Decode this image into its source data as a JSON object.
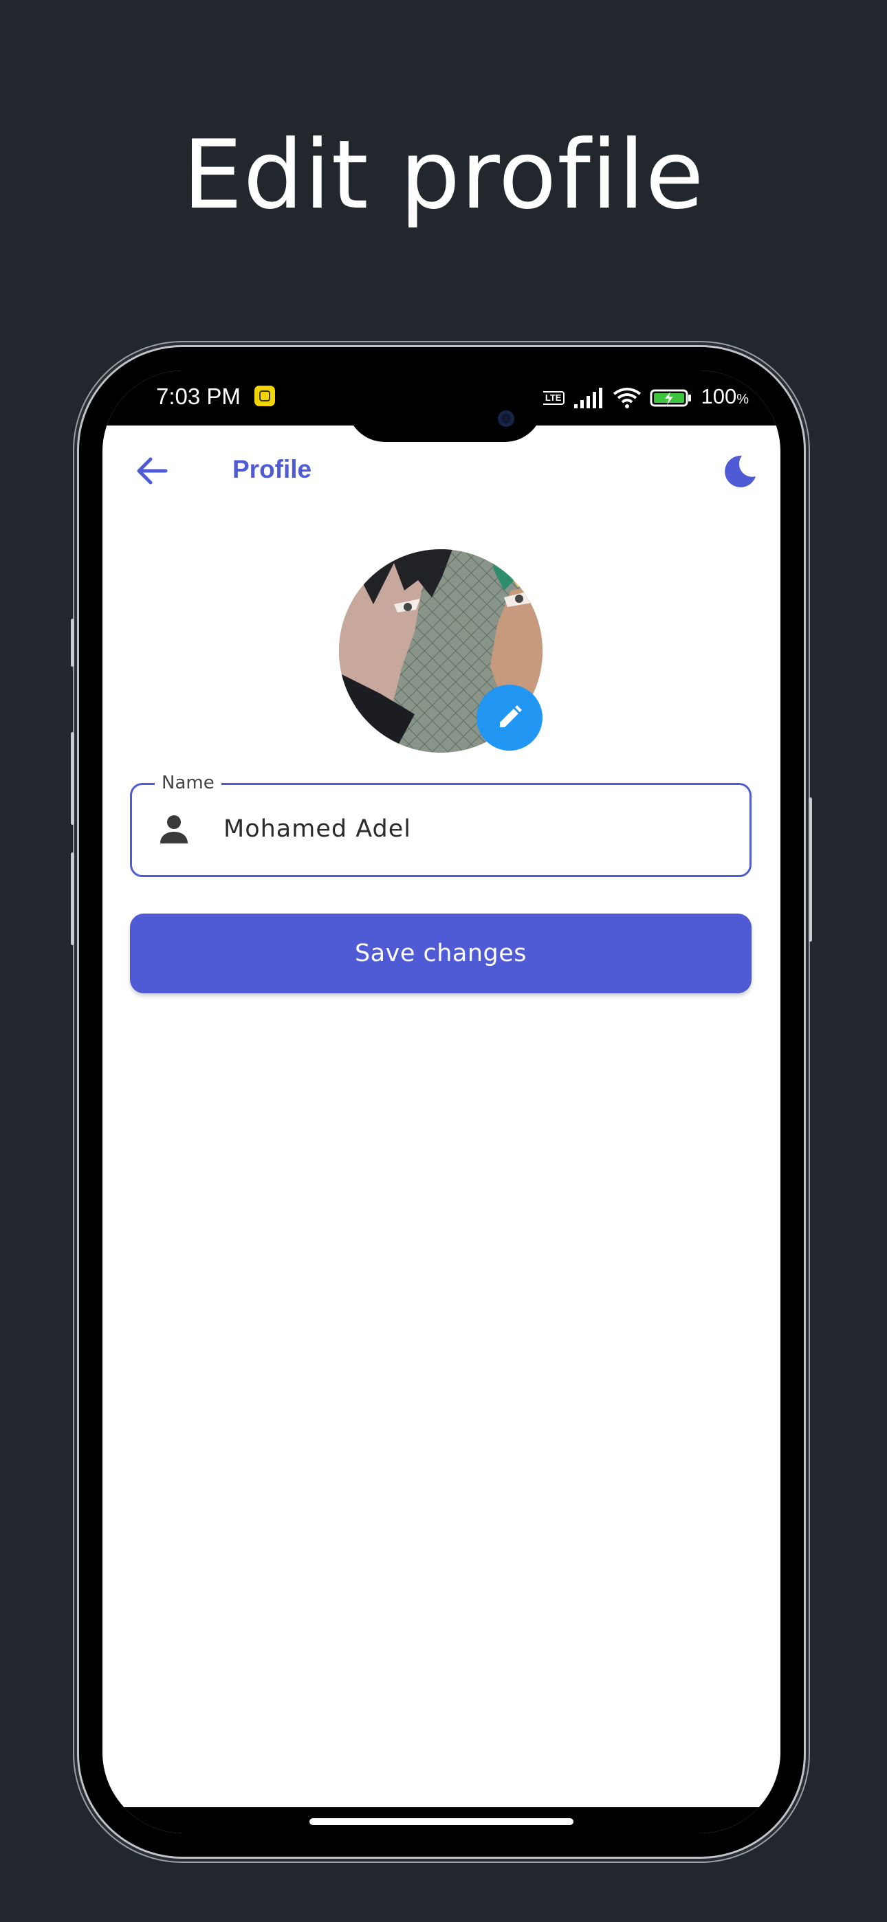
{
  "page": {
    "headline": "Edit profile",
    "background_color": "#22262d"
  },
  "status_bar": {
    "time": "7:03 PM",
    "volte_badge": "Vo LTE",
    "battery": "100",
    "battery_suffix": "%",
    "icons": [
      "notification-app-icon",
      "signal-icon",
      "wifi-icon",
      "battery-charging-icon"
    ]
  },
  "appbar": {
    "title": "Profile",
    "back_icon": "arrow-back-icon",
    "theme_icon": "moon-icon",
    "accent_color": "#4f5bd5"
  },
  "profile": {
    "avatar_icon": "avatar-image",
    "edit_icon": "pencil-icon",
    "edit_button_color": "#2196f3"
  },
  "form": {
    "name_label": "Name",
    "name_value": "Mohamed Adel",
    "name_icon": "person-icon",
    "save_label": "Save changes",
    "save_color": "#4f5bd5"
  }
}
